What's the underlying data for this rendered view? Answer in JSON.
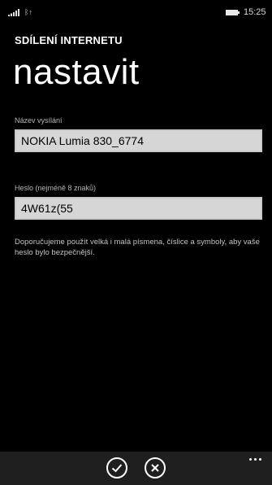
{
  "status_bar": {
    "signal_icon": "signal-strength-icon",
    "wifi_text": "ᛒ↑",
    "battery_icon": "battery-icon",
    "time": "15:25"
  },
  "header": {
    "app_title": "SDÍLENÍ INTERNETU",
    "page_title": "nastavit"
  },
  "form": {
    "broadcast_name": {
      "label": "Název vysílání",
      "value": "NOKIA Lumia 830_6774"
    },
    "password": {
      "label": "Heslo (nejméně 8 znaků)",
      "value": "4W61z(55"
    },
    "hint": "Doporučujeme použít velká i malá písmena, číslice a symboly, aby vaše heslo bylo bezpečnější."
  },
  "app_bar": {
    "buttons": [
      {
        "icon": "checkmark-icon",
        "action": "confirm"
      },
      {
        "icon": "close-icon",
        "action": "cancel"
      }
    ],
    "more_icon": "more-ellipsis-icon"
  },
  "colors": {
    "background": "#000000",
    "input_background": "#d6d6d6",
    "app_bar_background": "#1f1f1f",
    "label_gray": "#b5b5b5"
  }
}
